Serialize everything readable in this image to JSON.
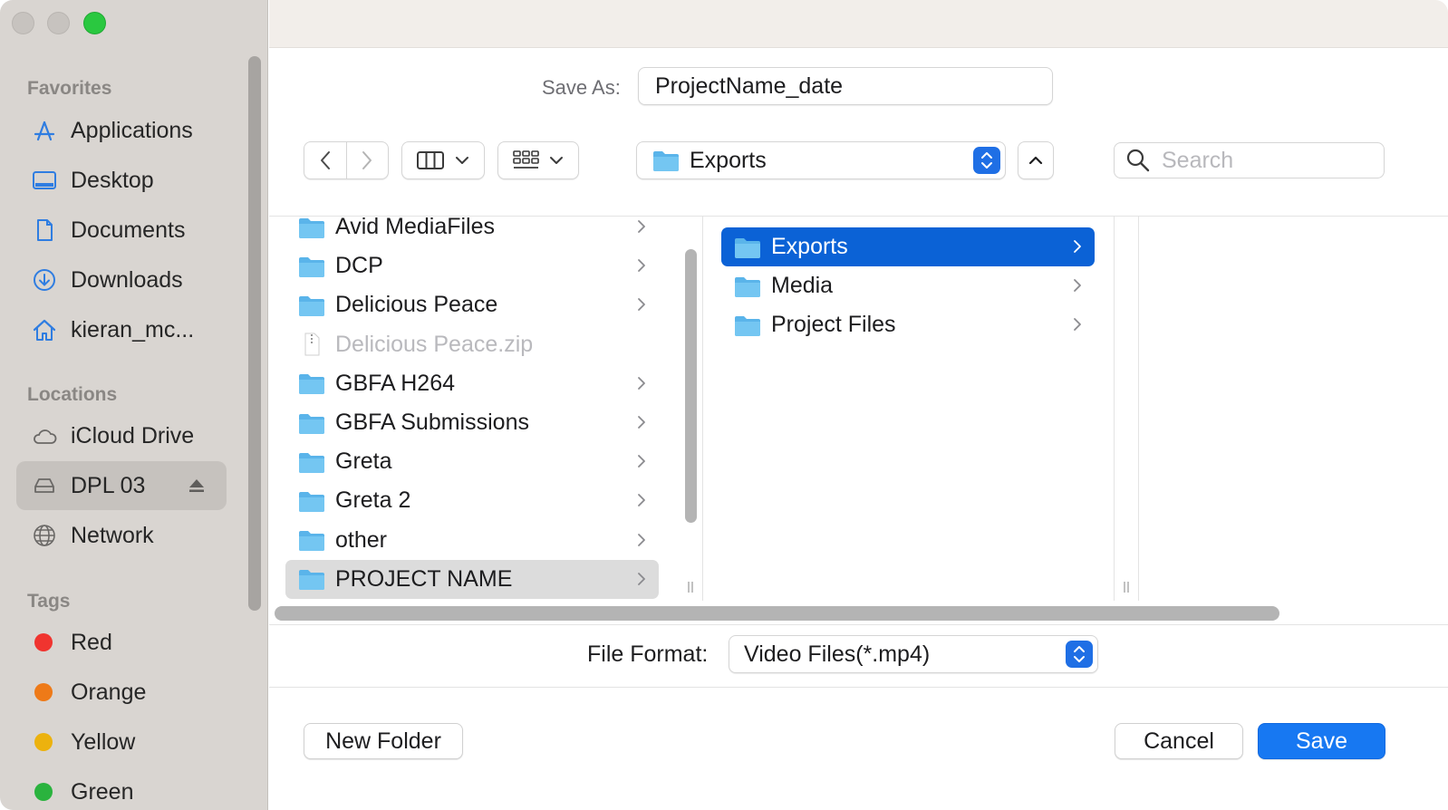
{
  "sidebar": {
    "favorites_header": "Favorites",
    "favorites": [
      {
        "label": "Applications",
        "icon": "applications-icon"
      },
      {
        "label": "Desktop",
        "icon": "desktop-icon"
      },
      {
        "label": "Documents",
        "icon": "document-icon"
      },
      {
        "label": "Downloads",
        "icon": "downloads-icon"
      },
      {
        "label": "kieran_mc...",
        "icon": "home-icon"
      }
    ],
    "locations_header": "Locations",
    "locations": [
      {
        "label": "iCloud Drive",
        "icon": "cloud-icon"
      },
      {
        "label": "DPL 03",
        "icon": "drive-icon",
        "selected": true
      },
      {
        "label": "Network",
        "icon": "globe-icon"
      }
    ],
    "tags_header": "Tags",
    "tags": [
      {
        "label": "Red",
        "color": "#f0342f"
      },
      {
        "label": "Orange",
        "color": "#ee7a18"
      },
      {
        "label": "Yellow",
        "color": "#ecb20e"
      },
      {
        "label": "Green",
        "color": "#2ab33e"
      }
    ]
  },
  "save_as": {
    "label": "Save As:",
    "value": "ProjectName_date"
  },
  "toolbar": {
    "location": "Exports",
    "search_placeholder": "Search"
  },
  "browser": {
    "column1": [
      {
        "name": "Avid MediaFiles",
        "type": "folder"
      },
      {
        "name": "DCP",
        "type": "folder"
      },
      {
        "name": "Delicious Peace",
        "type": "folder"
      },
      {
        "name": "Delicious Peace.zip",
        "type": "file",
        "dim": true
      },
      {
        "name": "GBFA H264",
        "type": "folder"
      },
      {
        "name": "GBFA Submissions",
        "type": "folder"
      },
      {
        "name": "Greta",
        "type": "folder"
      },
      {
        "name": "Greta 2",
        "type": "folder"
      },
      {
        "name": "other",
        "type": "folder"
      },
      {
        "name": "PROJECT NAME",
        "type": "folder",
        "selected": true
      }
    ],
    "column2": [
      {
        "name": "Exports",
        "type": "folder",
        "selected": true
      },
      {
        "name": "Media",
        "type": "folder"
      },
      {
        "name": "Project Files",
        "type": "folder"
      }
    ]
  },
  "file_format": {
    "label": "File Format:",
    "value": "Video Files(*.mp4)"
  },
  "buttons": {
    "new_folder": "New Folder",
    "cancel": "Cancel",
    "save": "Save"
  },
  "colors": {
    "accent": "#1778f2",
    "selection": "#0b62d6",
    "folder": "#5ab4ea"
  }
}
